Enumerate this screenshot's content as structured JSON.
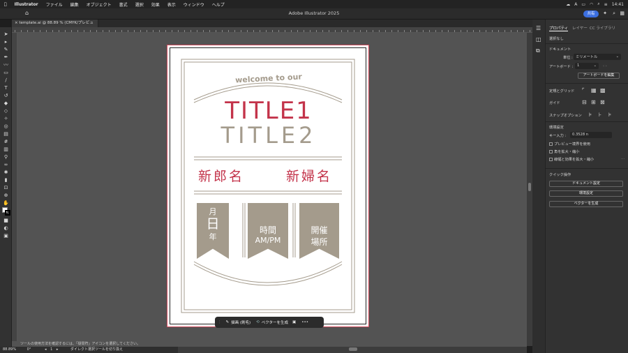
{
  "menubar": {
    "app": "Illustrator",
    "items": [
      "ファイル",
      "編集",
      "オブジェクト",
      "書式",
      "選択",
      "効果",
      "表示",
      "ウィンドウ",
      "ヘルプ"
    ],
    "clock": "14:41"
  },
  "appbar": {
    "title": "Adobe Illustrator 2025",
    "share": "共有"
  },
  "document": {
    "tab": "template.ai @ 88.89 % (CMYK/プレビュー)"
  },
  "artwork": {
    "welcome": "welcome to our",
    "title1": "TITLE1",
    "title2": "TITLE2",
    "groom": "新郎名",
    "bride": "新婦名",
    "banner1_top": "月",
    "banner1_mid": "日",
    "banner1_bot": "年",
    "banner2_l1": "時間",
    "banner2_l2": "AM/PM",
    "banner3_l1": "開催",
    "banner3_l2": "場所",
    "red": "#c3334a",
    "grey": "#a49b8c"
  },
  "taskbar": {
    "draw": "描画 (刷毛)",
    "vector": "ベクターを生成"
  },
  "panel": {
    "tabs": [
      "プロパティ",
      "レイヤー",
      "CC ライブラリ"
    ],
    "selection": "選択なし",
    "document_label": "ドキュメント",
    "unit_label": "単位 :",
    "unit_value": "ミリメートル",
    "artboard_label": "アートボード :",
    "artboard_value": "1",
    "edit_artboard": "アートボードを編集",
    "rulers_grid": "定規とグリッド",
    "guides": "ガイド",
    "snap_options": "スナップオプション",
    "prefs_label": "環境設定",
    "key_input_label": "キー入力 :",
    "key_input_value": "0.3528 n",
    "check1": "プレビュー境界を使用",
    "check2": "角を拡大・縮小",
    "check3": "線幅と効果を拡大・縮小",
    "quick_actions": "クイック操作",
    "btn_doc_settings": "ドキュメント設定",
    "btn_prefs": "環境設定",
    "btn_vector": "ベクターを生成"
  },
  "status": {
    "hint": "ツールの使用方法を確認するには、「疑問符」アイコンを選択してください。",
    "zoom": "88.89%",
    "angle": "0°",
    "artboard_num": "1",
    "tool": "ダイレクト選択ツールを切り換え"
  }
}
